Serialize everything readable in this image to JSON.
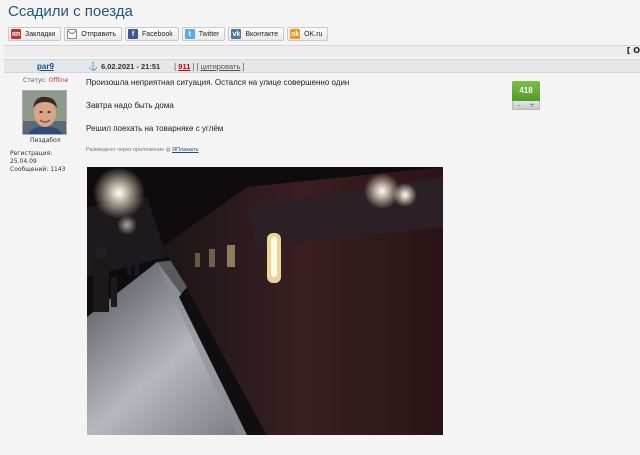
{
  "topic": {
    "title": "Ссадили с поезда"
  },
  "share": [
    {
      "name": "bookmarks",
      "icon": "bookmark-icon",
      "label": "Закладки"
    },
    {
      "name": "send",
      "icon": "mail-icon",
      "label": "Отправить"
    },
    {
      "name": "facebook",
      "icon": "facebook-icon",
      "label": "Facebook"
    },
    {
      "name": "twitter",
      "icon": "twitter-icon",
      "label": "Twitter"
    },
    {
      "name": "vkontakte",
      "icon": "vk-icon",
      "label": "Вконтакте"
    },
    {
      "name": "okru",
      "icon": "odnoklassniki-icon",
      "label": "OK.ru"
    }
  ],
  "nav": {
    "right_mark": "[ О"
  },
  "post": {
    "author": "par9",
    "date": "6.02.2021 - 21:51",
    "number": "911",
    "quote_label": "цитировать",
    "bracket_open": "[",
    "bracket_mid": "] [",
    "bracket_close": "]",
    "lines": [
      "Произошла неприятная ситуация. Остался на улице совершенно один",
      "Завтра надо быть дома",
      "Решил поехать на товарняке с углём"
    ],
    "via_text": "Размещено через приложение",
    "via_app": "ЯПлакалъ",
    "rating": "418",
    "rating_minus": "–",
    "rating_plus": "+"
  },
  "user": {
    "status_label": "Статус:",
    "status_value": "Offline",
    "rank": "Пиздабол",
    "registered": "Регистрация: 25.04.09",
    "messages": "Сообщений: 1143"
  },
  "colors": {
    "title": "#26557a",
    "rating": "#5fa832",
    "offline": "#cc3333",
    "post_number": "#cc0000"
  }
}
